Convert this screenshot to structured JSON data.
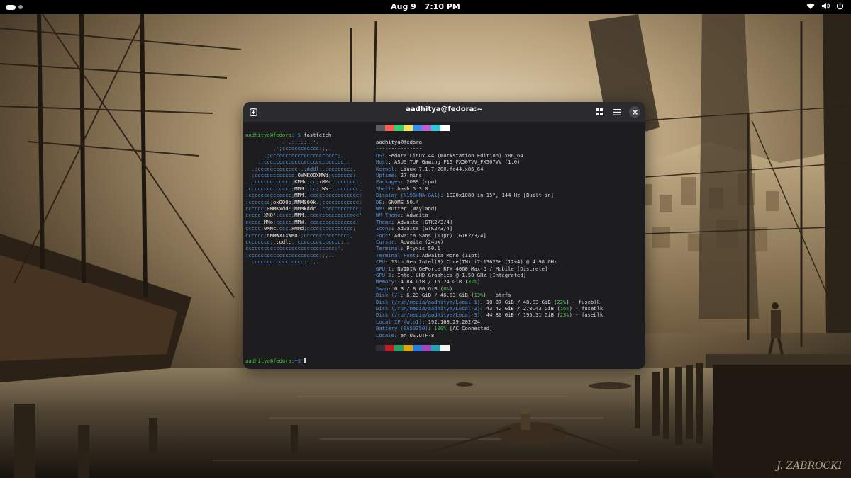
{
  "topbar": {
    "date": "Aug 9",
    "time": "7:10 PM",
    "icons": [
      "activities-indicator",
      "wifi-icon",
      "volume-icon",
      "power-icon"
    ]
  },
  "window": {
    "title": "aadhitya@fedora:~",
    "subtitle": "~",
    "buttons": [
      "new-tab-icon",
      "tab-overview-icon",
      "hamburger-menu-icon",
      "close-icon"
    ]
  },
  "terminal": {
    "prompt_user": "aadhitya@fedora",
    "prompt_path": ":~$",
    "command": " fastfetch",
    "logo": [
      "            .',;::::;,'.",
      "         .';cccccccccccc:;,.",
      "      .;cccccccccccccccccccccc;.",
      "    .:cccccccccccccccccccccccccc:.",
      "  .;ccccccccccccc;.:dddl:.;ccccccc;.",
      " .:ccccccccccccc;OWMKOOXMWd;ccccccc:.",
      ".:ccccccccccccc;KMMc;cc;xMMc;ccccccc:.",
      ",cccccccccccccc;MMM.;cc;;WW:;cccccccc,",
      ":cccccccccccccc;MMM.;cccccccccccccccc:",
      ":ccccccc;oxOOOo;MMM000k.;cccccccccccc:",
      "cccccc;0MMKxdd:;MMMkddc.;cccccccccccc;",
      "ccccc;XMO';cccc;MMM.;cccccccccccccccc'",
      "ccccc;MMo;ccccc;MMW.;ccccccccccccccc;",
      "ccccc;0MNc.ccc.xMMd;ccccccccccccccc;",
      "cccccc;dNMWXXXWM0:;cccccccccccccc:,",
      "cccccccc;.:odl:.;cccccccccccccc:,.",
      "ccccccccccccccccccccccccccccc:'.",
      ":ccccccccccccccccccccccc:;,..",
      " ':cccccccccccccccc::;,."
    ],
    "logo_white_segments": [
      "OWMKOOXMWd",
      "KMMc",
      "xMMc",
      "MMM",
      "WW:",
      "oxOOOo",
      "MMM000k",
      "0MMKxdd:",
      "MMMkddc",
      "XMO'",
      "MMW",
      "MMo",
      "0MNc",
      "xMMd",
      "dNMWXXXWM0:",
      ":odl:"
    ],
    "header_user": "aadhitya@fedora",
    "separator": "---------------",
    "info": [
      {
        "key": "OS",
        "value": ": Fedora Linux 44 (Workstation Edition) x86_64"
      },
      {
        "key": "Host",
        "value": ": ASUS TUF Gaming F15 FX507VV_FX507VV (1.0)"
      },
      {
        "key": "Kernel",
        "value": ": Linux 7.1.7-200.fc44.x86_64"
      },
      {
        "key": "Uptime",
        "value": ": 27 mins"
      },
      {
        "key": "Packages",
        "value": ": 2089 (rpm)"
      },
      {
        "key": "Shell",
        "value": ": bash 5.3.0"
      },
      {
        "key": "Display (N156HMA-GA1)",
        "value": ": 1920x1080 in 15\", 144 Hz [Built-in]"
      },
      {
        "key": "DE",
        "value": ": GNOME 50.4"
      },
      {
        "key": "WM",
        "value": ": Mutter (Wayland)"
      },
      {
        "key": "WM Theme",
        "value": ": Adwaita"
      },
      {
        "key": "Theme",
        "value": ": Adwaita [GTK2/3/4]"
      },
      {
        "key": "Icons",
        "value": ": Adwaita [GTK2/3/4]"
      },
      {
        "key": "Font",
        "value": ": Adwaita Sans (11pt) [GTK2/3/4]"
      },
      {
        "key": "Cursor",
        "value": ": Adwaita (24px)"
      },
      {
        "key": "Terminal",
        "value": ": Ptyxis 50.1"
      },
      {
        "key": "Terminal Font",
        "value": ": Adwaita Mono (11pt)"
      },
      {
        "key": "CPU",
        "value": ": 13th Gen Intel(R) Core(TM) i7-13620H (12+4) @ 4.90 GHz"
      },
      {
        "key": "GPU 1",
        "value": ": NVIDIA GeForce RTX 4060 Max-Q / Mobile [Discrete]"
      },
      {
        "key": "GPU 2",
        "value": ": Intel UHD Graphics @ 1.50 GHz [Integrated]"
      },
      {
        "key": "Memory",
        "value": ": 4.84 GiB / 15.24 GiB (",
        "pct": "32%",
        "tail": ")"
      },
      {
        "key": "Swap",
        "value": ": 0 B / 8.00 GiB (",
        "pct": "0%",
        "tail": ")"
      },
      {
        "key": "Disk (/)",
        "value": ": 6.23 GiB / 46.83 GiB (",
        "pct": "13%",
        "tail": ") - btrfs"
      },
      {
        "key": "Disk (/run/media/aadhitya/Local-1)",
        "value": ": 10.87 GiB / 48.83 GiB (",
        "pct": "22%",
        "tail": ") - fuseblk"
      },
      {
        "key": "Disk (/run/media/aadhitya/Local-2)",
        "value": ": 43.42 GiB / 270.43 GiB (",
        "pct": "16%",
        "tail": ") - fuseblk"
      },
      {
        "key": "Disk (/run/media/aadhitya/Local-3)",
        "value": ": 44.80 GiB / 195.31 GiB (",
        "pct": "23%",
        "tail": ") - fuseblk"
      },
      {
        "key": "Local IP (wlo1)",
        "value": ": 192.168.29.202/24"
      },
      {
        "key": "Battery (0A50350)",
        "value": ": ",
        "pct": "100%",
        "tail": " [AC Connected]"
      },
      {
        "key": "Locale",
        "value": ": en_US.UTF-8"
      }
    ],
    "palette": [
      "#2e2e36",
      "#c01c28",
      "#26a269",
      "#e5a50a",
      "#2a7bde",
      "#a347ba",
      "#2aa1b3",
      "#f6f5f4"
    ],
    "palette2": [
      "#5e5c64",
      "#f66151",
      "#33d17a",
      "#f8e45c",
      "#3b8eea",
      "#c061cb",
      "#33c7de",
      "#ffffff"
    ]
  },
  "signature": "J. ZABROCKI"
}
